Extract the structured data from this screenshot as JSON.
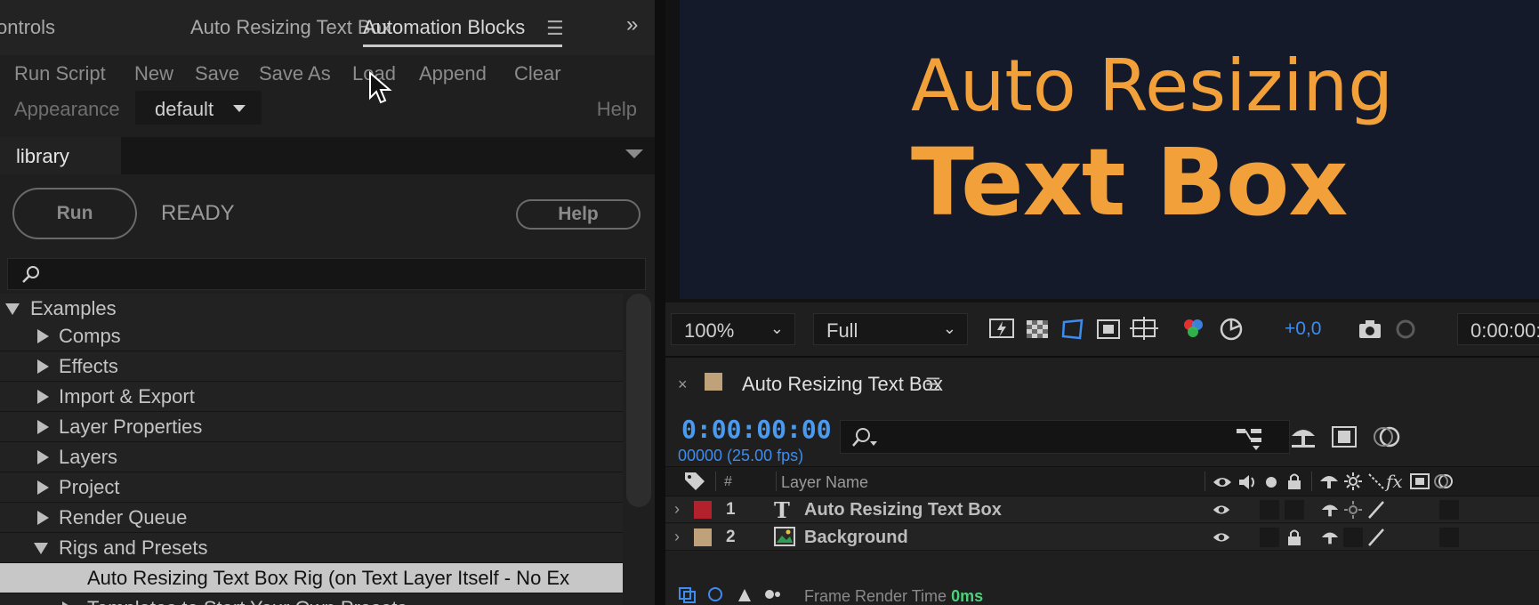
{
  "left_panel": {
    "tabs": {
      "controls": "ontrols",
      "auto_resizing": "Auto Resizing  Text Box",
      "automation_blocks": "Automation Blocks",
      "menu_glyph": "☰",
      "expand_glyph": "»"
    },
    "toolbar": {
      "run_script": "Run Script",
      "new": "New",
      "save": "Save",
      "save_as": "Save As",
      "load": "Load",
      "append": "Append",
      "clear": "Clear",
      "appearance_label": "Appearance",
      "appearance_value": "default",
      "help": "Help"
    },
    "library_tab": "library",
    "run_button": "Run",
    "status": "READY",
    "help_button": "Help",
    "search": {
      "placeholder": ""
    },
    "tree": [
      {
        "label": "Examples",
        "expanded": true
      },
      {
        "label": "Comps",
        "expanded": false
      },
      {
        "label": "Effects",
        "expanded": false
      },
      {
        "label": "Import & Export",
        "expanded": false
      },
      {
        "label": "Layer Properties",
        "expanded": false
      },
      {
        "label": "Layers",
        "expanded": false
      },
      {
        "label": "Project",
        "expanded": false
      },
      {
        "label": "Render Queue",
        "expanded": false
      },
      {
        "label": "Rigs and Presets",
        "expanded": true
      },
      {
        "label": "Auto Resizing Text Box Rig (on Text Layer Itself - No Ex",
        "selected": true
      },
      {
        "label": "Templates to Start Your Own Presets",
        "expanded": false
      }
    ]
  },
  "preview": {
    "line1": "Auto Resizing",
    "line2": "Text Box",
    "text_color": "#f2a03a",
    "bg_color": "#141a2a"
  },
  "viewer_bar": {
    "zoom": "100%",
    "resolution": "Full",
    "exposure": "+0,0",
    "timecode": "0:00:00:"
  },
  "timeline": {
    "tab_title": "Auto Resizing Text Box",
    "menu_glyph": "☰",
    "close_glyph": "×",
    "current_time": "0:00:00:00",
    "frame_info": "00000 (25.00 fps)",
    "columns": {
      "hash": "#",
      "layer_name": "Layer Name"
    },
    "layers": [
      {
        "num": "1",
        "name": "Auto Resizing  Text Box",
        "type": "text",
        "color": "#b3212d"
      },
      {
        "num": "2",
        "name": "Background",
        "type": "image",
        "color": "#bfa27a"
      }
    ],
    "footer_label": "Frame Render Time",
    "footer_value": "0ms"
  },
  "colors": {
    "accent_blue": "#3d8cf0",
    "selection": "#c7c7c7"
  }
}
